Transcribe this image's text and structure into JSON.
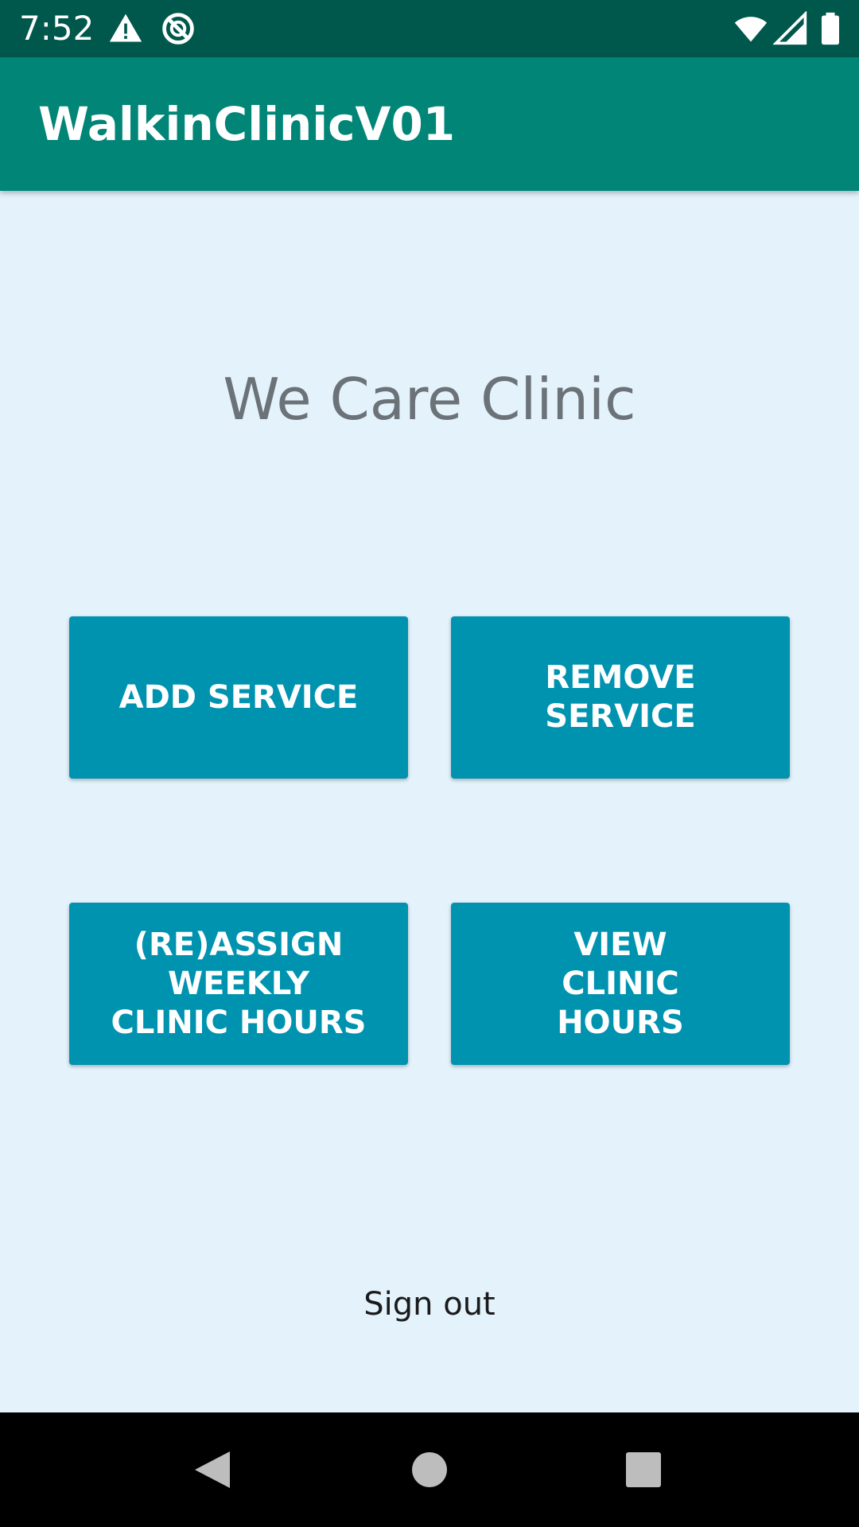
{
  "status_bar": {
    "time": "7:52",
    "left_icons": [
      "warning-icon",
      "do-not-disturb-icon"
    ],
    "right_icons": [
      "wifi-icon",
      "cell-signal-icon",
      "battery-icon"
    ],
    "background": "#00574b"
  },
  "app_bar": {
    "title": "WalkinClinicV01",
    "background": "#008577"
  },
  "main": {
    "clinic_name": "We Care Clinic",
    "buttons": {
      "add_service": "ADD SERVICE",
      "remove_service": "REMOVE SERVICE",
      "reassign_hours": "(RE)ASSIGN WEEKLY CLINIC HOURS",
      "view_hours": "VIEW CLINIC HOURS"
    },
    "button_color": "#0093b0",
    "sign_out": "Sign out"
  },
  "nav_bar": {
    "icons": [
      "back-icon",
      "home-icon",
      "recents-icon"
    ]
  }
}
